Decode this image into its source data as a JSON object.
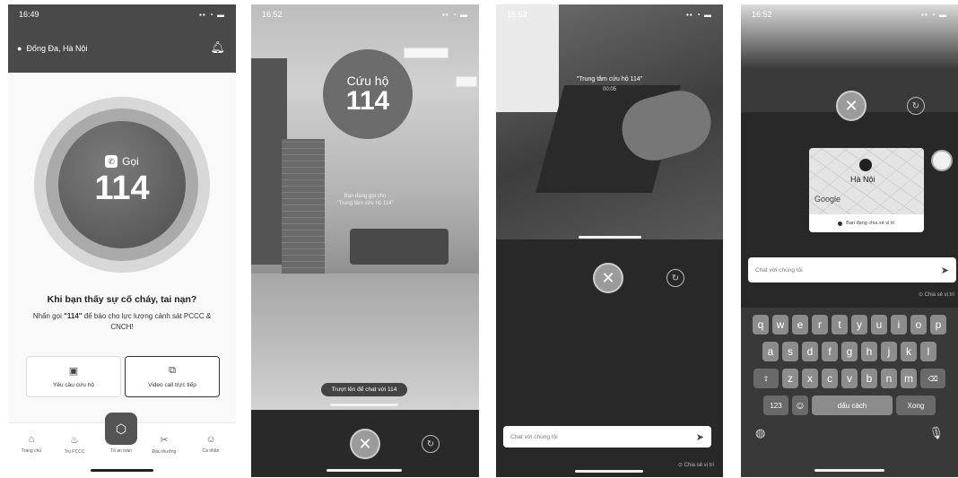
{
  "screen1": {
    "time": "16:49",
    "location": "Đống Đa, Hà Nội",
    "call_label": "Gọi",
    "call_number": "114",
    "headline": "Khi bạn thấy sự cố cháy, tai nạn?",
    "description_prefix": "Nhấn gọi ",
    "description_bold": "\"114\"",
    "description_suffix": " để báo cho lực lượng cảnh sát PCCC & CNCH!",
    "card_rescue": "Yêu cầu cứu hộ",
    "card_video": "Video call trực tiếp",
    "nav": [
      "Trang chủ",
      "Trụ PCCC",
      "Tố an toàn",
      "Đấu thưởng",
      "Cá nhân"
    ]
  },
  "screen2": {
    "time": "16:52",
    "bubble_title": "Cứu hộ",
    "bubble_number": "114",
    "overlay_line1": "Bạn đang gọi cho",
    "overlay_line2": "\"Trung tâm cứu hộ 114\"",
    "swipe_label": "Trượt lên để chat với 114"
  },
  "screen3": {
    "time": "16:52",
    "caption": "\"Trung tâm cứu hộ 114\"",
    "timer": "00:05",
    "chat_placeholder": "Chat với chúng tôi",
    "share_location": "Chia sẻ vị trí"
  },
  "screen4": {
    "time": "16:52",
    "map_city": "Hà Nội",
    "map_brand": "Google",
    "map_footer": "Bạn đang chia sẻ vị trí",
    "chat_placeholder": "Chat với chúng tôi",
    "share_location": "Chia sẻ vị trí",
    "keyboard_row1": [
      "q",
      "w",
      "e",
      "r",
      "t",
      "y",
      "u",
      "i",
      "o",
      "p"
    ],
    "keyboard_row2": [
      "a",
      "s",
      "d",
      "f",
      "g",
      "h",
      "j",
      "k",
      "l"
    ],
    "keyboard_row3": [
      "z",
      "x",
      "c",
      "v",
      "b",
      "n",
      "m"
    ],
    "key_123": "123",
    "key_space": "dấu cách",
    "key_return": "Xong"
  }
}
